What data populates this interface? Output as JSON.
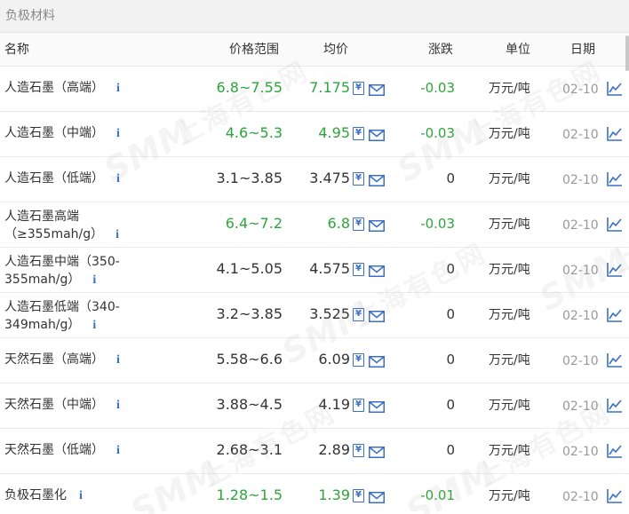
{
  "section": {
    "title": "负极材料"
  },
  "columns": {
    "name": "名称",
    "price_range": "价格范围",
    "average": "均价",
    "change": "涨跌",
    "unit": "单位",
    "date": "日期"
  },
  "info_glyph": "i",
  "yen_glyph": "¥",
  "watermark": {
    "brand": "SMM",
    "text": "上海有色网"
  },
  "colors": {
    "green": "#2da53a",
    "blue_icon": "#3a6fc4",
    "header_bg": "#f2f2f2"
  },
  "rows": [
    {
      "name_line1": "人造石墨（高端）",
      "name_line2": "",
      "range": "6.8~7.55",
      "avg": "7.175",
      "change": "-0.03",
      "unit": "万元/吨",
      "date": "02-10",
      "highlight": true
    },
    {
      "name_line1": "人造石墨（中端）",
      "name_line2": "",
      "range": "4.6~5.3",
      "avg": "4.95",
      "change": "-0.03",
      "unit": "万元/吨",
      "date": "02-10",
      "highlight": true
    },
    {
      "name_line1": "人造石墨（低端）",
      "name_line2": "",
      "range": "3.1~3.85",
      "avg": "3.475",
      "change": "0",
      "unit": "万元/吨",
      "date": "02-10",
      "highlight": false
    },
    {
      "name_line1": "人造石墨高端",
      "name_line2": "（≥355mah/g）",
      "range": "6.4~7.2",
      "avg": "6.8",
      "change": "-0.03",
      "unit": "万元/吨",
      "date": "02-10",
      "highlight": true
    },
    {
      "name_line1": "人造石墨中端（350-",
      "name_line2": "355mah/g）",
      "range": "4.1~5.05",
      "avg": "4.575",
      "change": "0",
      "unit": "万元/吨",
      "date": "02-10",
      "highlight": false
    },
    {
      "name_line1": "人造石墨低端（340-",
      "name_line2": "349mah/g）",
      "range": "3.2~3.85",
      "avg": "3.525",
      "change": "0",
      "unit": "万元/吨",
      "date": "02-10",
      "highlight": false
    },
    {
      "name_line1": "天然石墨（高端）",
      "name_line2": "",
      "range": "5.58~6.6",
      "avg": "6.09",
      "change": "0",
      "unit": "万元/吨",
      "date": "02-10",
      "highlight": false
    },
    {
      "name_line1": "天然石墨（中端）",
      "name_line2": "",
      "range": "3.88~4.5",
      "avg": "4.19",
      "change": "0",
      "unit": "万元/吨",
      "date": "02-10",
      "highlight": false
    },
    {
      "name_line1": "天然石墨（低端）",
      "name_line2": "",
      "range": "2.68~3.1",
      "avg": "2.89",
      "change": "0",
      "unit": "万元/吨",
      "date": "02-10",
      "highlight": false
    },
    {
      "name_line1": "负极石墨化",
      "name_line2": "",
      "range": "1.28~1.5",
      "avg": "1.39",
      "change": "-0.01",
      "unit": "万元/吨",
      "date": "02-10",
      "highlight": true
    }
  ]
}
